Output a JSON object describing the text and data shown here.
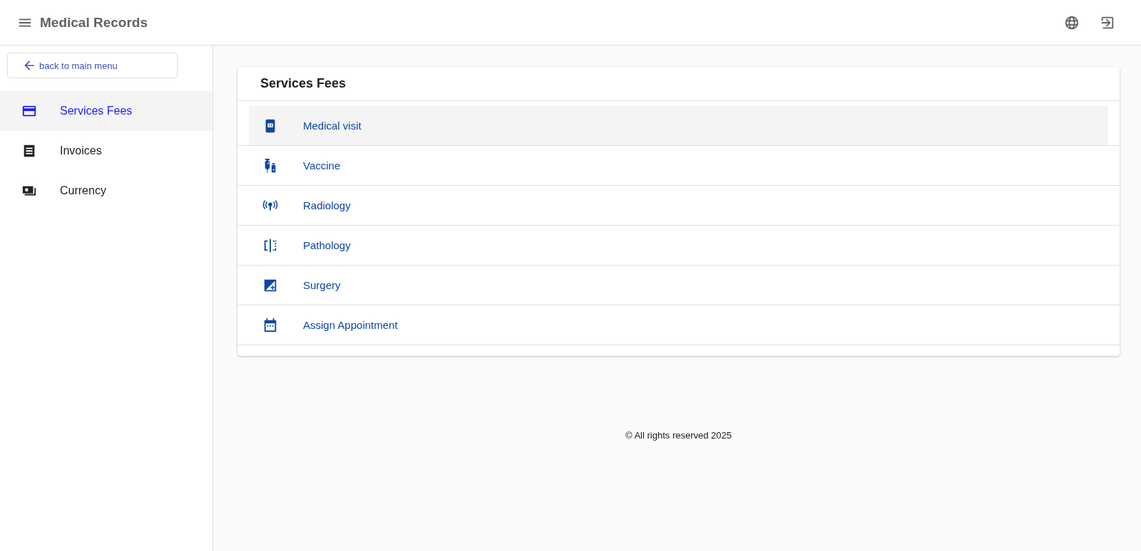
{
  "header": {
    "title": "Medical Records"
  },
  "sidebar": {
    "back_button": "back to main menu",
    "items": [
      {
        "label": "Services Fees",
        "selected": true
      },
      {
        "label": "Invoices",
        "selected": false
      },
      {
        "label": "Currency",
        "selected": false
      }
    ]
  },
  "card": {
    "title": "Services Fees",
    "items": [
      {
        "label": "Medical visit",
        "selected": true
      },
      {
        "label": "Vaccine",
        "selected": false
      },
      {
        "label": "Radiology",
        "selected": false
      },
      {
        "label": "Pathology",
        "selected": false
      },
      {
        "label": "Surgery",
        "selected": false
      },
      {
        "label": "Assign Appointment",
        "selected": false
      }
    ]
  },
  "footer": {
    "text": "© All rights reserved 2025"
  }
}
